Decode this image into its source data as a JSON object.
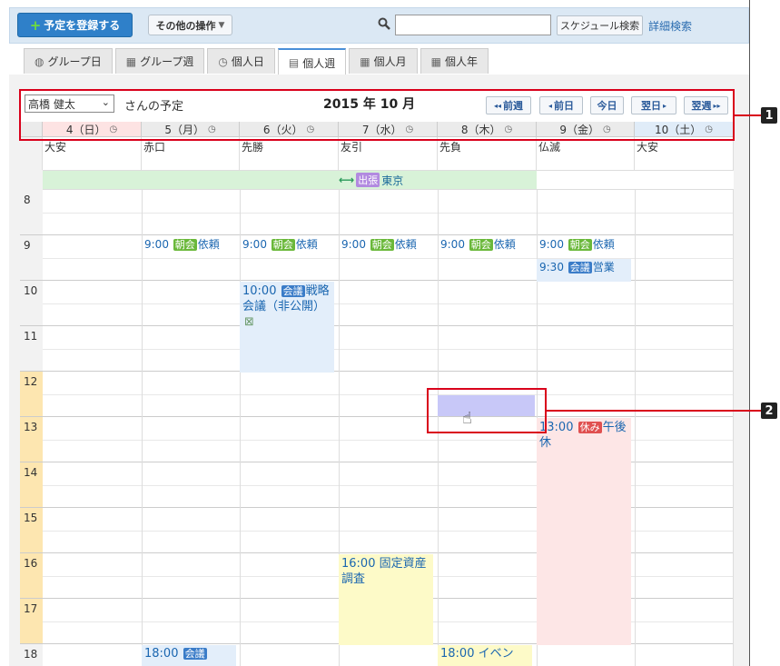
{
  "toolbar": {
    "register_label": "予定を登録する",
    "other_ops_label": "その他の操作",
    "search_value": "",
    "search_button": "スケジュール検索",
    "detail_search": "詳細検索"
  },
  "tabs": [
    {
      "label": "グループ日",
      "icon": "group-day-icon"
    },
    {
      "label": "グループ週",
      "icon": "group-week-icon"
    },
    {
      "label": "個人日",
      "icon": "clock-icon"
    },
    {
      "label": "個人週",
      "icon": "personal-week-icon",
      "active": true
    },
    {
      "label": "個人月",
      "icon": "calendar-month-icon"
    },
    {
      "label": "個人年",
      "icon": "calendar-year-icon"
    }
  ],
  "header": {
    "user": "高橋 健太",
    "san_label": "さんの予定",
    "month_title": "2015 年 10 月",
    "prev_week": "前週",
    "prev_day": "前日",
    "today": "今日",
    "next_day": "翌日",
    "next_week": "翌週"
  },
  "days": [
    {
      "label": "4（日）",
      "rokuyo": "大安",
      "color": "#fde3e3"
    },
    {
      "label": "5（月）",
      "rokuyo": "赤口",
      "color": "#ebebeb"
    },
    {
      "label": "6（火）",
      "rokuyo": "先勝",
      "color": "#ebebeb"
    },
    {
      "label": "7（水）",
      "rokuyo": "友引",
      "color": "#ebebeb"
    },
    {
      "label": "8（木）",
      "rokuyo": "先負",
      "color": "#ebebeb"
    },
    {
      "label": "9（金）",
      "rokuyo": "仏滅",
      "color": "#ebebeb"
    },
    {
      "label": "10（土）",
      "rokuyo": "大安",
      "color": "#e0ecf8"
    }
  ],
  "allday": {
    "tag": "出張",
    "text": "東京"
  },
  "hours": [
    "8",
    "9",
    "10",
    "11",
    "12",
    "13",
    "14",
    "15",
    "16",
    "17",
    "18"
  ],
  "events": {
    "e9_mon": {
      "time": "9:00",
      "tag": "朝会",
      "text": "依頼"
    },
    "e9_tue": {
      "time": "9:00",
      "tag": "朝会",
      "text": "依頼"
    },
    "e9_wed": {
      "time": "9:00",
      "tag": "朝会",
      "text": "依頼"
    },
    "e9_thu": {
      "time": "9:00",
      "tag": "朝会",
      "text": "依頼"
    },
    "e9_fri": {
      "time": "9:00",
      "tag": "朝会",
      "text": "依頼"
    },
    "e930_fri": {
      "time": "9:30",
      "tag": "会議",
      "text": "営業"
    },
    "e10_tue": {
      "time": "10:00",
      "tag": "会議",
      "text": "戦略会議（非公開）"
    },
    "e13_fri": {
      "time": "13:00",
      "tag": "休み",
      "text": "午後休"
    },
    "e16_wed": {
      "time": "16:00",
      "text": "固定資産調査"
    },
    "e18_mon": {
      "time": "18:00",
      "tag": "会議"
    },
    "e18_thu": {
      "time": "18:00",
      "text": "イベン"
    }
  },
  "callouts": [
    "1",
    "2"
  ],
  "colors": {
    "accent": "#2f80c9",
    "highlight": "#d9001b",
    "selection": "#c8c8f8"
  }
}
